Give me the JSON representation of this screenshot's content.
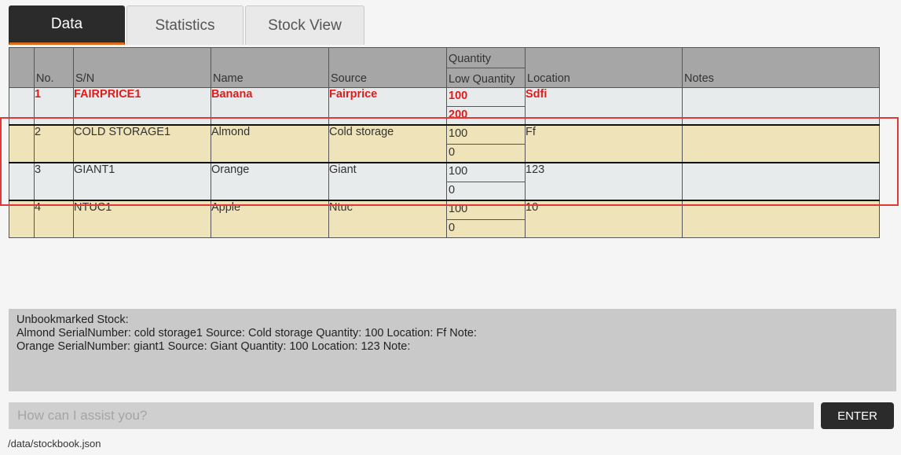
{
  "tabs": [
    {
      "label": "Data",
      "active": true
    },
    {
      "label": "Statistics",
      "active": false
    },
    {
      "label": "Stock View",
      "active": false
    }
  ],
  "table": {
    "headers": {
      "index": "",
      "no": "No.",
      "sn": "S/N",
      "name": "Name",
      "source": "Source",
      "quantity": "Quantity",
      "low_quantity": "Low Quantity",
      "location": "Location",
      "notes": "Notes"
    },
    "rows": [
      {
        "no": "1",
        "sn": "FAIRPRICE1",
        "name": "Banana",
        "source": "Fairprice",
        "quantity": "100",
        "low_quantity": "200",
        "location": "Sdfi",
        "notes": ""
      },
      {
        "no": "2",
        "sn": "COLD STORAGE1",
        "name": "Almond",
        "source": "Cold storage",
        "quantity": "100",
        "low_quantity": "0",
        "location": "Ff",
        "notes": ""
      },
      {
        "no": "3",
        "sn": "GIANT1",
        "name": "Orange",
        "source": "Giant",
        "quantity": "100",
        "low_quantity": "0",
        "location": "123",
        "notes": ""
      },
      {
        "no": "4",
        "sn": "NTUC1",
        "name": "Apple",
        "source": "Ntuc",
        "quantity": "100",
        "low_quantity": "0",
        "location": "10",
        "notes": ""
      }
    ]
  },
  "result": {
    "text": "Unbookmarked Stock:\nAlmond SerialNumber: cold storage1 Source: Cold storage Quantity: 100 Location: Ff Note:\nOrange SerialNumber: giant1 Source: Giant Quantity: 100 Location: 123 Note:"
  },
  "command": {
    "placeholder": "How can I assist you?",
    "value": "",
    "enter_label": "ENTER"
  },
  "status": {
    "path": "/data/stockbook.json"
  },
  "colors": {
    "accent": "#d96b19",
    "selected_text": "#e01b1b",
    "highlight": "#e0393a",
    "row_light": "#e8ebec",
    "row_tan": "#efe4b9",
    "header": "#a7a6a6"
  }
}
